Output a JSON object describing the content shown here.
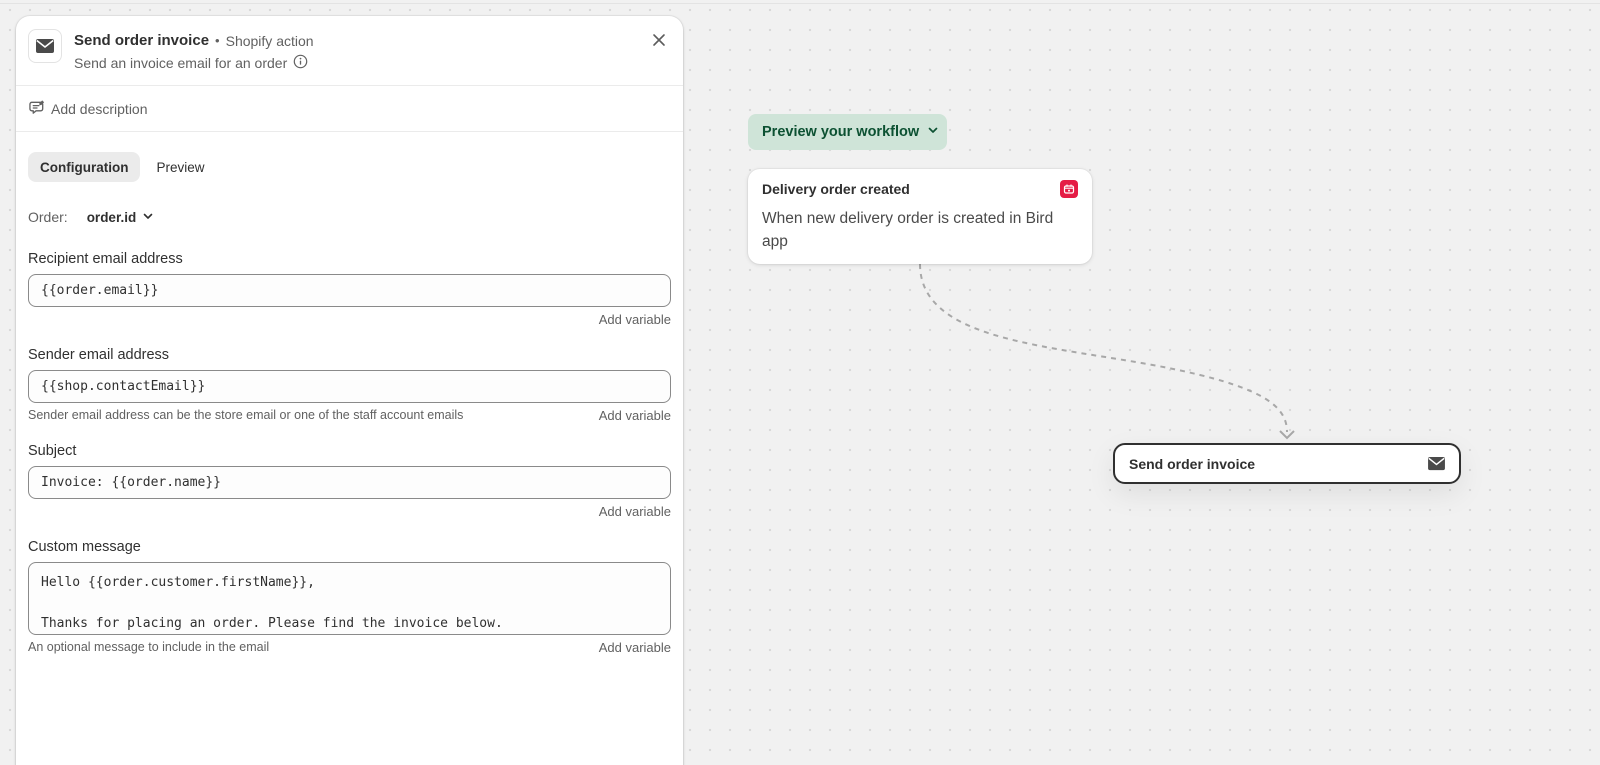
{
  "panel": {
    "title": "Send order invoice",
    "separator": "•",
    "source": "Shopify action",
    "subtitle": "Send an invoice email for an order",
    "add_description": "Add description",
    "tabs": [
      {
        "label": "Configuration",
        "active": true
      },
      {
        "label": "Preview",
        "active": false
      }
    ],
    "order": {
      "label": "Order:",
      "value": "order.id"
    },
    "fields": {
      "recipient": {
        "label": "Recipient email address",
        "value": "{{order.email}}",
        "add_variable": "Add variable"
      },
      "sender": {
        "label": "Sender email address",
        "value": "{{shop.contactEmail}}",
        "helper": "Sender email address can be the store email or one of the staff account emails",
        "add_variable": "Add variable"
      },
      "subject": {
        "label": "Subject",
        "value": "Invoice: {{order.name}}",
        "add_variable": "Add variable"
      },
      "message": {
        "label": "Custom message",
        "line1": "Hello {{order.customer.firstName}},",
        "line2": "Thanks for placing an order. Please find the invoice below.",
        "helper": "An optional message to include in the email",
        "add_variable": "Add variable"
      }
    }
  },
  "canvas": {
    "preview_button": "Preview your workflow",
    "trigger": {
      "title": "Delivery order created",
      "description": "When new delivery order is created in Bird app",
      "badge_color": "#e51c45"
    },
    "action": {
      "title": "Send order invoice"
    }
  },
  "icons": {
    "header": "envelope-icon",
    "close": "close-icon",
    "info": "info-icon",
    "description": "chat-edit-icon",
    "chevron": "chevron-down-icon",
    "trigger_badge": "app-badge-icon",
    "action": "envelope-icon"
  },
  "colors": {
    "accent_green_bg": "#cfe4d8",
    "accent_green_text": "#0c5132",
    "text": "#303030",
    "muted": "#616161"
  }
}
